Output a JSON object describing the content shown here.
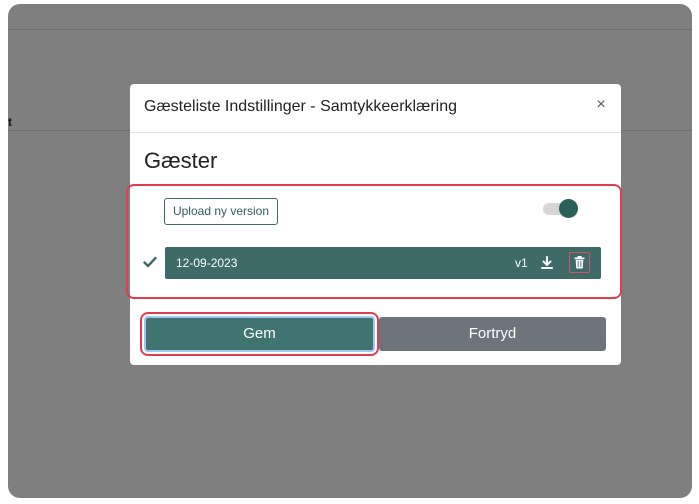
{
  "background": {
    "stray_text": "t"
  },
  "modal": {
    "title": "Gæsteliste Indstillinger - Samtykkeerklæring",
    "close_symbol": "×",
    "section_title": "Gæster"
  },
  "upload": {
    "label": "Upload ny version"
  },
  "toggle": {
    "state": "on"
  },
  "versions": [
    {
      "date": "12-09-2023",
      "version": "v1",
      "selected": true
    }
  ],
  "actions": {
    "save_label": "Gem",
    "cancel_label": "Fortryd"
  },
  "colors": {
    "overlay": "#7f7f7f",
    "primary": "#3e6b67",
    "secondary": "#6d747b",
    "highlight": "#e23c50"
  },
  "icons": {
    "close": "close-icon",
    "check": "check-icon",
    "download": "download-icon",
    "trash": "trash-icon"
  }
}
